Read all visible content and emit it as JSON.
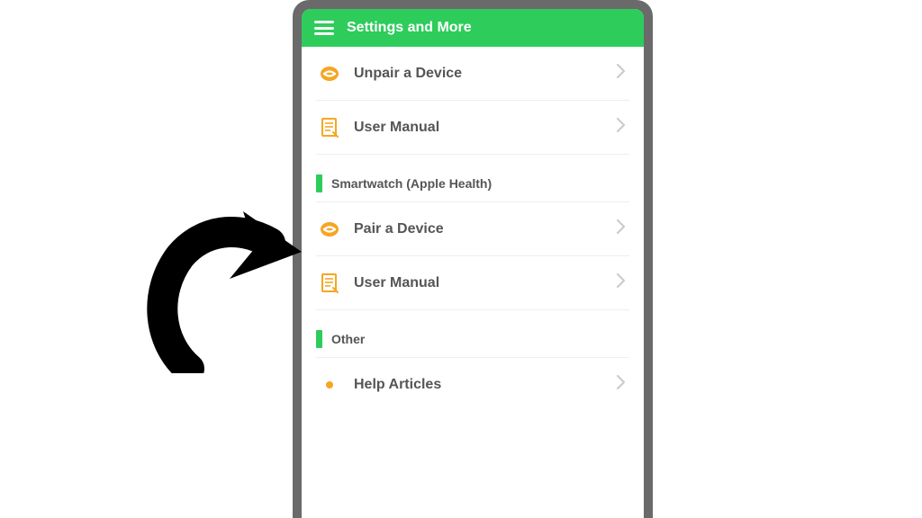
{
  "header": {
    "title": "Settings and More"
  },
  "items_top": [
    {
      "label": "Unpair a Device",
      "icon": "link"
    },
    {
      "label": "User Manual",
      "icon": "doc"
    }
  ],
  "section1": {
    "title": "Smartwatch (Apple Health)",
    "items": [
      {
        "label": "Pair a Device",
        "icon": "link"
      },
      {
        "label": "User Manual",
        "icon": "doc"
      }
    ]
  },
  "section2": {
    "title": "Other",
    "items": [
      {
        "label": "Help Articles",
        "icon": "bullet"
      }
    ]
  },
  "colors": {
    "accent": "#2ecc5b",
    "iconOrange": "#f5a623",
    "text": "#555555"
  }
}
